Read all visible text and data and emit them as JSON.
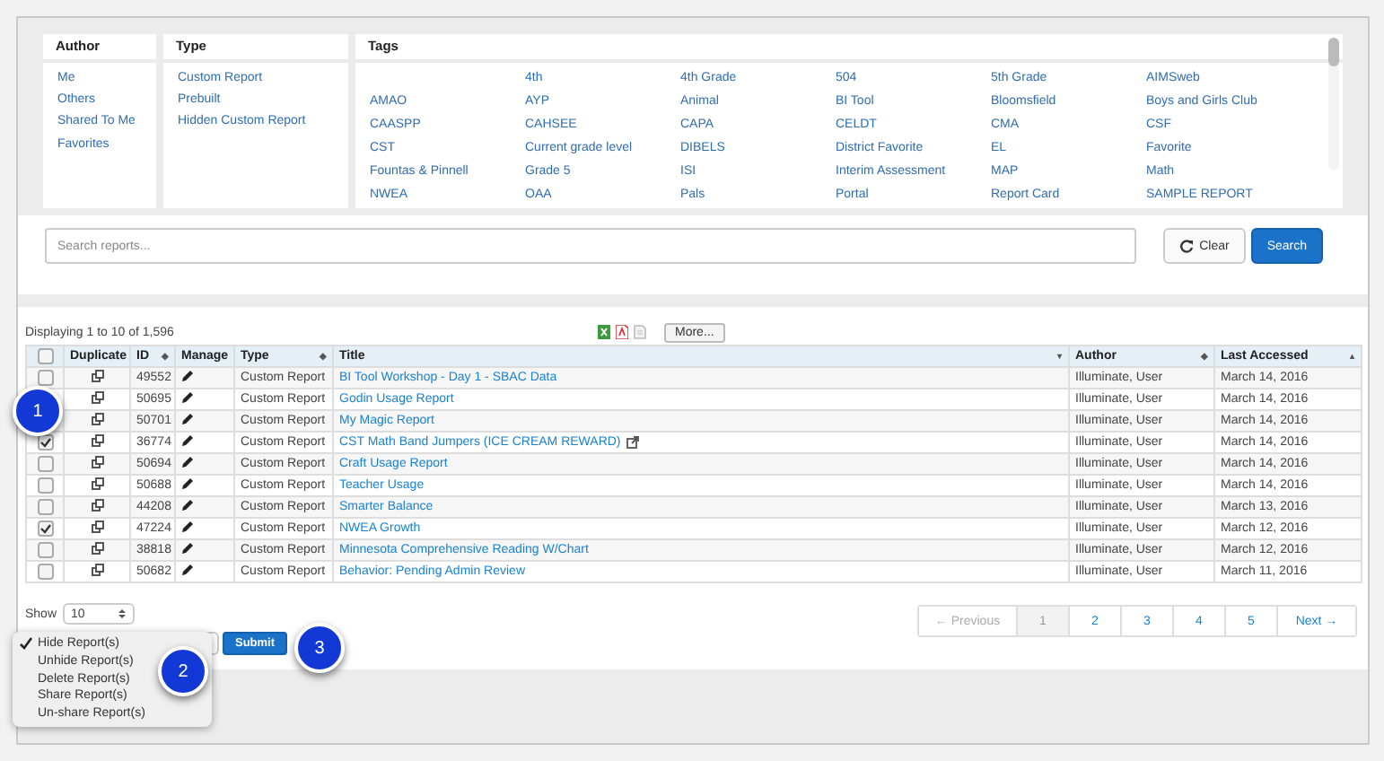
{
  "filters": {
    "author": {
      "heading": "Author",
      "items": [
        "Me",
        "Others",
        "Shared To Me",
        "Favorites"
      ]
    },
    "type": {
      "heading": "Type",
      "items": [
        "Custom Report",
        "Prebuilt",
        "Hidden Custom Report"
      ]
    },
    "tags": {
      "heading": "Tags",
      "items": [
        "4th",
        "4th Grade",
        "504",
        "5th Grade",
        "AIMSweb",
        "AMAO",
        "AYP",
        "Animal",
        "BI Tool",
        "Bloomsfield",
        "Boys and Girls Club",
        "CAASPP",
        "CAHSEE",
        "CAPA",
        "CELDT",
        "CMA",
        "CSF",
        "CST",
        "Current grade level",
        "DIBELS",
        "District Favorite",
        "EL",
        "Favorite",
        "Fountas & Pinnell",
        "Grade 5",
        "ISI",
        "Interim Assessment",
        "MAP",
        "Math",
        "NWEA",
        "OAA",
        "Pals",
        "Portal",
        "Report Card",
        "SAMPLE REPORT"
      ]
    }
  },
  "search": {
    "placeholder": "Search reports...",
    "clear_button": "Clear",
    "search_button": "Search"
  },
  "results": {
    "summary": "Displaying 1 to 10 of 1,596",
    "more_button": "More...",
    "select_all": {
      "checked": false
    },
    "columns": [
      {
        "label": "Duplicate"
      },
      {
        "label": "ID",
        "sort_mark": "◆"
      },
      {
        "label": "Manage"
      },
      {
        "label": "Type",
        "sort_mark": "◆"
      },
      {
        "label": "Title",
        "sort_mark": "▾"
      },
      {
        "label": "Author",
        "sort_mark": "◆"
      },
      {
        "label": "Last Accessed",
        "sort_mark": "▴"
      }
    ],
    "rows": [
      {
        "checked": false,
        "id": "49552",
        "type": "Custom Report",
        "title": "BI Tool Workshop - Day 1 - SBAC Data",
        "shared": false,
        "author": "Illuminate, User",
        "last_accessed": "March 14, 2016"
      },
      {
        "id": "50695",
        "type": "Custom Report",
        "title": "Godin Usage Report",
        "shared": false,
        "author": "Illuminate, User",
        "last_accessed": "March 14, 2016"
      },
      {
        "id": "50701",
        "type": "Custom Report",
        "title": "My Magic Report",
        "shared": false,
        "author": "Illuminate, User",
        "last_accessed": "March 14, 2016"
      },
      {
        "checked": true,
        "id": "36774",
        "type": "Custom Report",
        "title": "CST Math Band Jumpers (ICE CREAM REWARD)",
        "shared": true,
        "author": "Illuminate, User",
        "last_accessed": "March 14, 2016"
      },
      {
        "checked": false,
        "id": "50694",
        "type": "Custom Report",
        "title": "Craft Usage Report",
        "shared": false,
        "author": "Illuminate, User",
        "last_accessed": "March 14, 2016"
      },
      {
        "checked": false,
        "id": "50688",
        "type": "Custom Report",
        "title": "Teacher Usage",
        "shared": false,
        "author": "Illuminate, User",
        "last_accessed": "March 14, 2016"
      },
      {
        "checked": false,
        "id": "44208",
        "type": "Custom Report",
        "title": "Smarter Balance",
        "shared": false,
        "author": "Illuminate, User",
        "last_accessed": "March 13, 2016"
      },
      {
        "checked": true,
        "id": "47224",
        "type": "Custom Report",
        "title": "NWEA Growth",
        "shared": false,
        "author": "Illuminate, User",
        "last_accessed": "March 12, 2016"
      },
      {
        "checked": false,
        "id": "38818",
        "type": "Custom Report",
        "title": "Minnesota Comprehensive Reading W/Chart",
        "shared": false,
        "author": "Illuminate, User",
        "last_accessed": "March 12, 2016"
      },
      {
        "checked": false,
        "id": "50682",
        "type": "Custom Report",
        "title": "Behavior: Pending Admin Review",
        "shared": false,
        "author": "Illuminate, User",
        "last_accessed": "March 11, 2016"
      }
    ]
  },
  "show": {
    "label": "Show",
    "value": "10"
  },
  "pagination": {
    "previous": {
      "label": "← Previous",
      "disabled": true
    },
    "pages": [
      {
        "label": "1",
        "selected": true
      },
      {
        "label": "2",
        "selected": false
      },
      {
        "label": "3",
        "selected": false
      },
      {
        "label": "4",
        "selected": false
      },
      {
        "label": "5",
        "selected": false
      }
    ],
    "next": {
      "label": "Next →",
      "disabled": false
    }
  },
  "submit_button": "Submit",
  "action_menu": {
    "items": [
      {
        "label": "Hide Report(s)",
        "selected": true
      },
      {
        "label": "Unhide Report(s)",
        "selected": false
      },
      {
        "label": "Delete Report(s)",
        "selected": false
      },
      {
        "label": "Share Report(s)",
        "selected": false
      },
      {
        "label": "Un-share Report(s)",
        "selected": false
      }
    ]
  },
  "step_badges": [
    {
      "label": "1"
    },
    {
      "label": "2"
    },
    {
      "label": "3"
    }
  ]
}
